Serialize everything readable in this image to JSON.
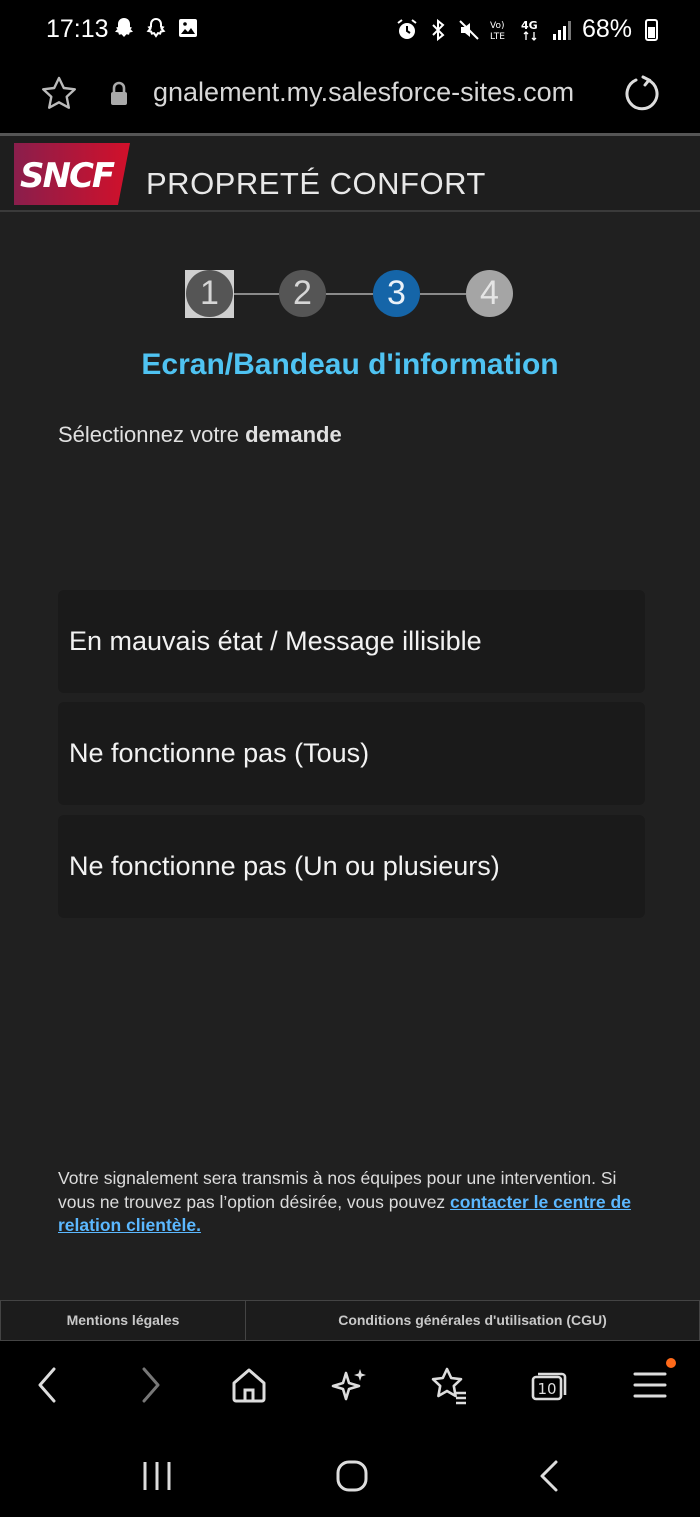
{
  "status_bar": {
    "time": "17:13",
    "battery": "68%",
    "network": "4G",
    "volte": "Vo) LTE",
    "left_icons": [
      "snapchat-icon",
      "snapchat-alt-icon",
      "gallery-icon"
    ],
    "right_icons": [
      "alarm-icon",
      "bluetooth-icon",
      "mute-icon",
      "volte-icon",
      "4g-icon",
      "signal-icon",
      "battery-icon"
    ]
  },
  "browser": {
    "url": "gnalement.my.salesforce-sites.com"
  },
  "header": {
    "logo_text": "SNCF",
    "title": "PROPRETÉ CONFORT"
  },
  "stepper": {
    "steps": [
      "1",
      "2",
      "3",
      "4"
    ],
    "current": 3
  },
  "section": {
    "title": "Ecran/Bandeau d'information",
    "instruction_prefix": "Sélectionnez votre ",
    "instruction_bold": "demande"
  },
  "options": [
    "En mauvais état / Message illisible",
    "Ne fonctionne pas (Tous)",
    "Ne fonctionne pas (Un ou plusieurs)"
  ],
  "notice": {
    "text": "Votre signalement sera transmis à nos équipes pour une intervention. Si vous ne trouvez pas l’option désirée, vous pouvez ",
    "link": "contacter le centre de relation clientèle."
  },
  "footer": {
    "mentions": "Mentions légales",
    "cgu": "Conditions générales d'utilisation (CGU)"
  },
  "toolbar": {
    "tab_count": "10"
  },
  "colors": {
    "accent": "#4fc3f2",
    "active_step": "#1565a8",
    "link": "#5bb8ff",
    "badge": "#ff6a1a"
  }
}
